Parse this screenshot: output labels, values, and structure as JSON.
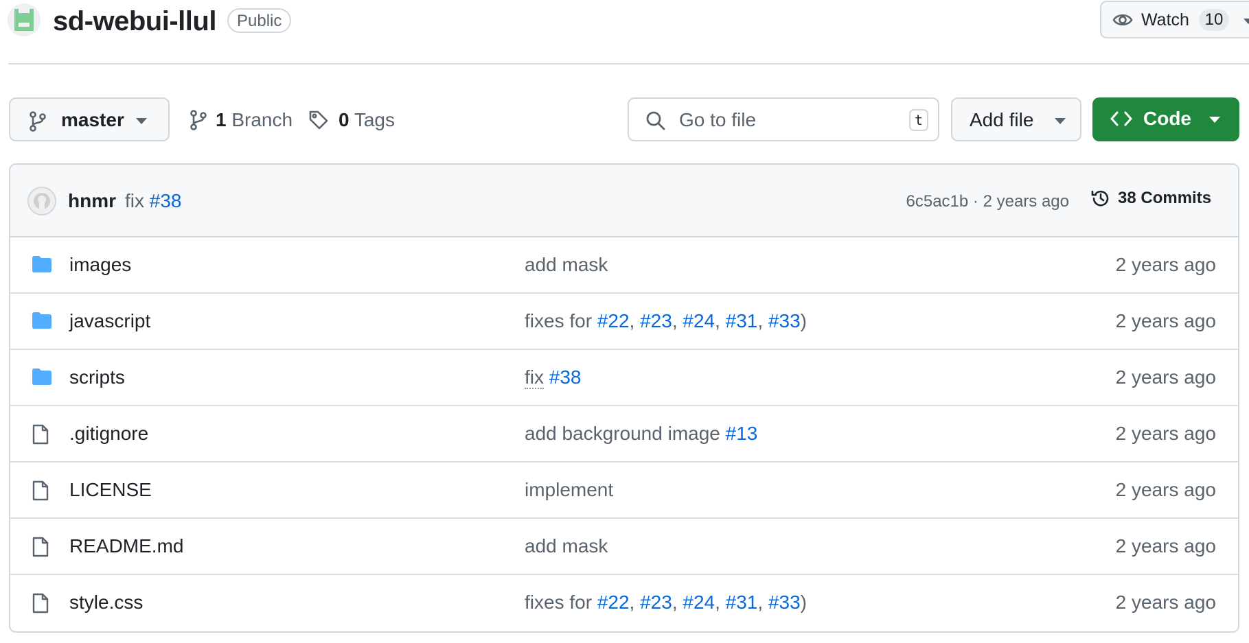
{
  "repo": {
    "name": "sd-webui-llul",
    "visibility": "Public",
    "watch_label": "Watch",
    "watch_count": "10"
  },
  "toolbar": {
    "branch_name": "master",
    "branch_count": "1",
    "branch_label": "Branch",
    "tag_count": "0",
    "tag_label": "Tags",
    "search_placeholder": "Go to file",
    "search_shortcut": "t",
    "add_file_label": "Add file",
    "code_label": "Code"
  },
  "latest_commit": {
    "author": "hnmr",
    "message_prefix": "fix",
    "issue": "#38",
    "sha": "6c5ac1b",
    "separator": " · ",
    "age": "2 years ago",
    "commits_label": "38 Commits"
  },
  "files": [
    {
      "type": "folder",
      "icon": "folder-icon",
      "name": "images",
      "message": [
        {
          "t": "add mask"
        }
      ],
      "age": "2 years ago"
    },
    {
      "type": "folder",
      "icon": "folder-icon",
      "name": "javascript",
      "message": [
        {
          "t": "fixes for "
        },
        {
          "l": "#22"
        },
        {
          "t": ", "
        },
        {
          "l": "#23"
        },
        {
          "t": ", "
        },
        {
          "l": "#24"
        },
        {
          "t": ", "
        },
        {
          "l": "#31"
        },
        {
          "t": ", "
        },
        {
          "l": "#33"
        },
        {
          "t": ")"
        }
      ],
      "age": "2 years ago"
    },
    {
      "type": "folder",
      "icon": "folder-icon",
      "name": "scripts",
      "message": [
        {
          "d": "fix"
        },
        {
          "t": " "
        },
        {
          "l": "#38"
        }
      ],
      "age": "2 years ago"
    },
    {
      "type": "file",
      "icon": "file-icon",
      "name": ".gitignore",
      "message": [
        {
          "t": "add background image "
        },
        {
          "l": "#13"
        }
      ],
      "age": "2 years ago"
    },
    {
      "type": "file",
      "icon": "file-icon",
      "name": "LICENSE",
      "message": [
        {
          "t": "implement"
        }
      ],
      "age": "2 years ago"
    },
    {
      "type": "file",
      "icon": "file-icon",
      "name": "README.md",
      "message": [
        {
          "t": "add mask"
        }
      ],
      "age": "2 years ago"
    },
    {
      "type": "file",
      "icon": "file-icon",
      "name": "style.css",
      "message": [
        {
          "t": "fixes for "
        },
        {
          "l": "#22"
        },
        {
          "t": ", "
        },
        {
          "l": "#23"
        },
        {
          "t": ", "
        },
        {
          "l": "#24"
        },
        {
          "t": ", "
        },
        {
          "l": "#31"
        },
        {
          "t": ", "
        },
        {
          "l": "#33"
        },
        {
          "t": ")"
        }
      ],
      "age": "2 years ago"
    }
  ],
  "colors": {
    "accent_link": "#0969da",
    "primary_button": "#1f883d",
    "folder": "#54aeff",
    "border": "#d0d7de",
    "muted_text": "#59636e"
  }
}
